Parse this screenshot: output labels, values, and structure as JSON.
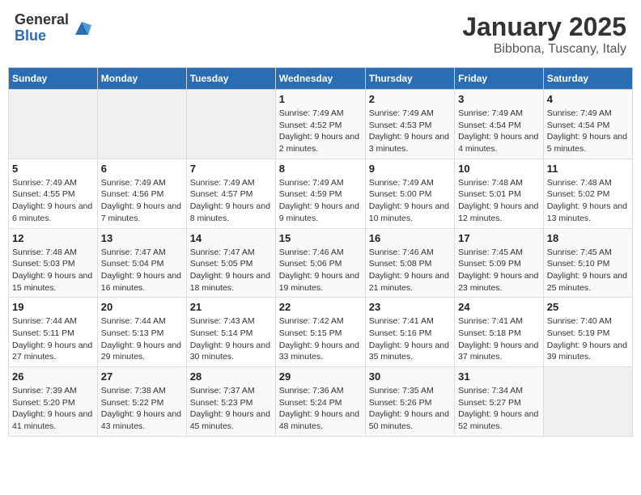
{
  "header": {
    "logo_general": "General",
    "logo_blue": "Blue",
    "month": "January 2025",
    "location": "Bibbona, Tuscany, Italy"
  },
  "days_of_week": [
    "Sunday",
    "Monday",
    "Tuesday",
    "Wednesday",
    "Thursday",
    "Friday",
    "Saturday"
  ],
  "weeks": [
    [
      {
        "day": "",
        "info": ""
      },
      {
        "day": "",
        "info": ""
      },
      {
        "day": "",
        "info": ""
      },
      {
        "day": "1",
        "info": "Sunrise: 7:49 AM\nSunset: 4:52 PM\nDaylight: 9 hours and 2 minutes."
      },
      {
        "day": "2",
        "info": "Sunrise: 7:49 AM\nSunset: 4:53 PM\nDaylight: 9 hours and 3 minutes."
      },
      {
        "day": "3",
        "info": "Sunrise: 7:49 AM\nSunset: 4:54 PM\nDaylight: 9 hours and 4 minutes."
      },
      {
        "day": "4",
        "info": "Sunrise: 7:49 AM\nSunset: 4:54 PM\nDaylight: 9 hours and 5 minutes."
      }
    ],
    [
      {
        "day": "5",
        "info": "Sunrise: 7:49 AM\nSunset: 4:55 PM\nDaylight: 9 hours and 6 minutes."
      },
      {
        "day": "6",
        "info": "Sunrise: 7:49 AM\nSunset: 4:56 PM\nDaylight: 9 hours and 7 minutes."
      },
      {
        "day": "7",
        "info": "Sunrise: 7:49 AM\nSunset: 4:57 PM\nDaylight: 9 hours and 8 minutes."
      },
      {
        "day": "8",
        "info": "Sunrise: 7:49 AM\nSunset: 4:59 PM\nDaylight: 9 hours and 9 minutes."
      },
      {
        "day": "9",
        "info": "Sunrise: 7:49 AM\nSunset: 5:00 PM\nDaylight: 9 hours and 10 minutes."
      },
      {
        "day": "10",
        "info": "Sunrise: 7:48 AM\nSunset: 5:01 PM\nDaylight: 9 hours and 12 minutes."
      },
      {
        "day": "11",
        "info": "Sunrise: 7:48 AM\nSunset: 5:02 PM\nDaylight: 9 hours and 13 minutes."
      }
    ],
    [
      {
        "day": "12",
        "info": "Sunrise: 7:48 AM\nSunset: 5:03 PM\nDaylight: 9 hours and 15 minutes."
      },
      {
        "day": "13",
        "info": "Sunrise: 7:47 AM\nSunset: 5:04 PM\nDaylight: 9 hours and 16 minutes."
      },
      {
        "day": "14",
        "info": "Sunrise: 7:47 AM\nSunset: 5:05 PM\nDaylight: 9 hours and 18 minutes."
      },
      {
        "day": "15",
        "info": "Sunrise: 7:46 AM\nSunset: 5:06 PM\nDaylight: 9 hours and 19 minutes."
      },
      {
        "day": "16",
        "info": "Sunrise: 7:46 AM\nSunset: 5:08 PM\nDaylight: 9 hours and 21 minutes."
      },
      {
        "day": "17",
        "info": "Sunrise: 7:45 AM\nSunset: 5:09 PM\nDaylight: 9 hours and 23 minutes."
      },
      {
        "day": "18",
        "info": "Sunrise: 7:45 AM\nSunset: 5:10 PM\nDaylight: 9 hours and 25 minutes."
      }
    ],
    [
      {
        "day": "19",
        "info": "Sunrise: 7:44 AM\nSunset: 5:11 PM\nDaylight: 9 hours and 27 minutes."
      },
      {
        "day": "20",
        "info": "Sunrise: 7:44 AM\nSunset: 5:13 PM\nDaylight: 9 hours and 29 minutes."
      },
      {
        "day": "21",
        "info": "Sunrise: 7:43 AM\nSunset: 5:14 PM\nDaylight: 9 hours and 30 minutes."
      },
      {
        "day": "22",
        "info": "Sunrise: 7:42 AM\nSunset: 5:15 PM\nDaylight: 9 hours and 33 minutes."
      },
      {
        "day": "23",
        "info": "Sunrise: 7:41 AM\nSunset: 5:16 PM\nDaylight: 9 hours and 35 minutes."
      },
      {
        "day": "24",
        "info": "Sunrise: 7:41 AM\nSunset: 5:18 PM\nDaylight: 9 hours and 37 minutes."
      },
      {
        "day": "25",
        "info": "Sunrise: 7:40 AM\nSunset: 5:19 PM\nDaylight: 9 hours and 39 minutes."
      }
    ],
    [
      {
        "day": "26",
        "info": "Sunrise: 7:39 AM\nSunset: 5:20 PM\nDaylight: 9 hours and 41 minutes."
      },
      {
        "day": "27",
        "info": "Sunrise: 7:38 AM\nSunset: 5:22 PM\nDaylight: 9 hours and 43 minutes."
      },
      {
        "day": "28",
        "info": "Sunrise: 7:37 AM\nSunset: 5:23 PM\nDaylight: 9 hours and 45 minutes."
      },
      {
        "day": "29",
        "info": "Sunrise: 7:36 AM\nSunset: 5:24 PM\nDaylight: 9 hours and 48 minutes."
      },
      {
        "day": "30",
        "info": "Sunrise: 7:35 AM\nSunset: 5:26 PM\nDaylight: 9 hours and 50 minutes."
      },
      {
        "day": "31",
        "info": "Sunrise: 7:34 AM\nSunset: 5:27 PM\nDaylight: 9 hours and 52 minutes."
      },
      {
        "day": "",
        "info": ""
      }
    ]
  ]
}
